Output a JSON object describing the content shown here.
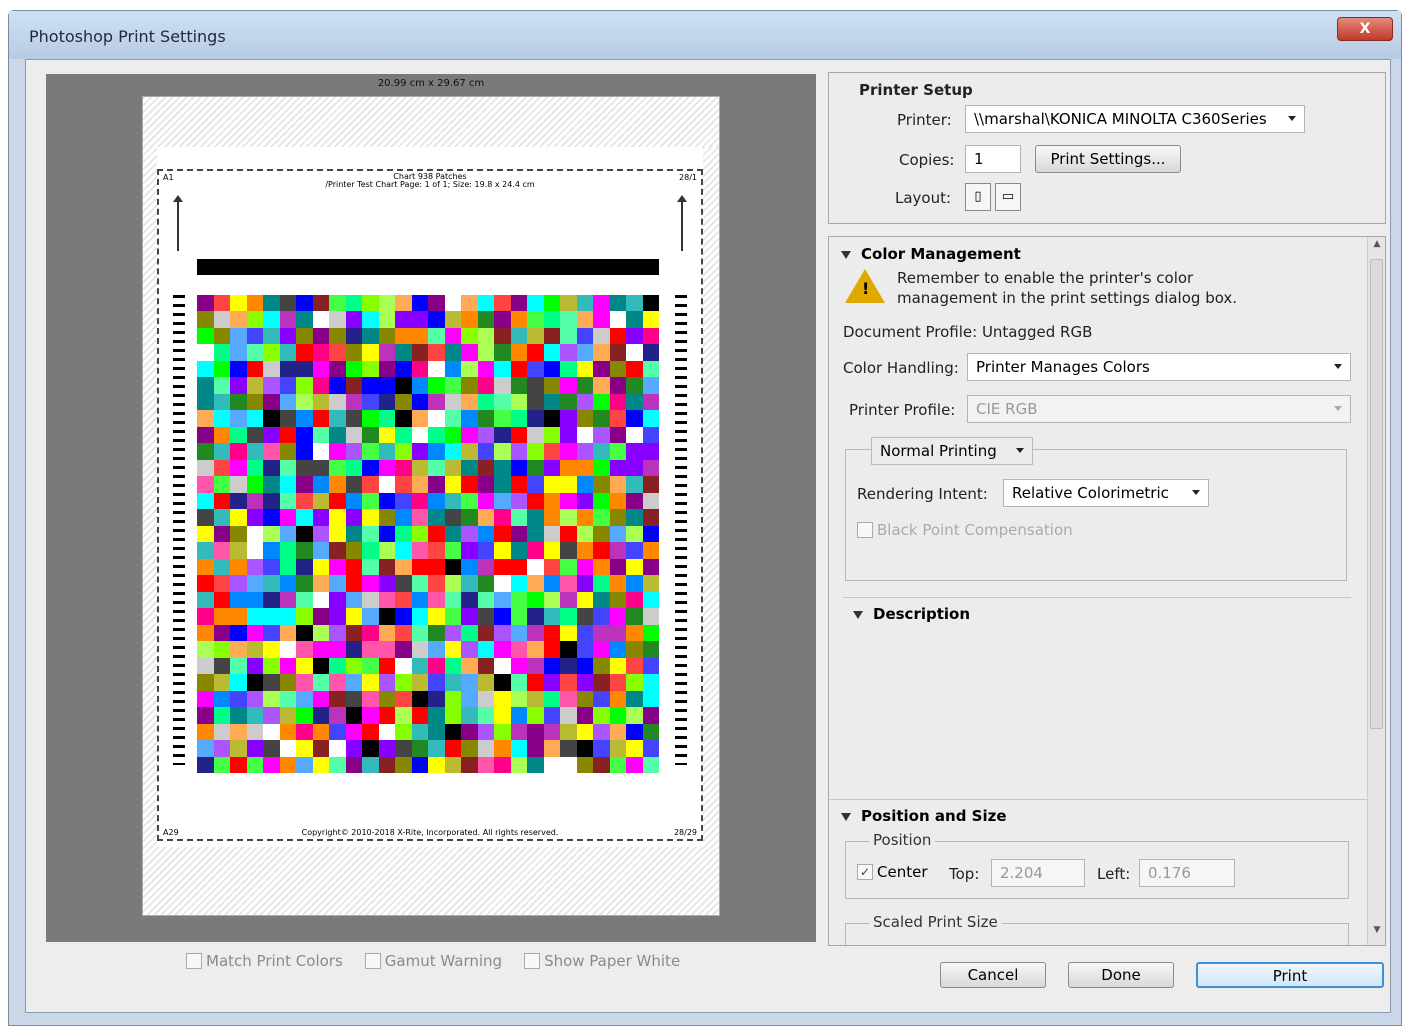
{
  "window": {
    "title": "Photoshop Print Settings",
    "close_label": "X"
  },
  "preview": {
    "page_size": "20.99 cm x 29.67 cm",
    "corner_tl": "A1",
    "corner_tr": "28/1",
    "corner_bl": "A29",
    "corner_br": "28/29",
    "chart_title": "Chart 938 Patches",
    "chart_subtitle": "/Printer Test Chart Page: 1 of 1; Size: 19.8 x 24.4 cm",
    "copyright": "Copyright© 2010-2018 X-Rite, Incorporated. All rights reserved.",
    "patch_colors": [
      "#ff0000",
      "#00ff00",
      "#0000ff",
      "#ffff00",
      "#ff00ff",
      "#00ffff",
      "#000000",
      "#ffffff",
      "#ff8800",
      "#88ff00",
      "#0088ff",
      "#8800ff",
      "#ff0088",
      "#00ff88",
      "#888800",
      "#008888",
      "#880088",
      "#444444",
      "#cccccc",
      "#ff4444",
      "#44ff44",
      "#4444ff",
      "#ffaa55",
      "#55aaff",
      "#aa55ff",
      "#55ffaa",
      "#aaff55",
      "#ff55aa",
      "#222288",
      "#882222",
      "#228822",
      "#bbbb33",
      "#33bbbb",
      "#bb33bb"
    ]
  },
  "under_preview": {
    "match_print_colors": "Match Print Colors",
    "gamut_warning": "Gamut Warning",
    "show_paper_white": "Show Paper White"
  },
  "printer_setup": {
    "heading": "Printer Setup",
    "printer_label": "Printer:",
    "printer_value": "\\\\marshal\\KONICA MINOLTA C360Series",
    "copies_label": "Copies:",
    "copies_value": "1",
    "print_settings_button": "Print Settings...",
    "layout_label": "Layout:",
    "layout_portrait": "▯",
    "layout_landscape": "▭"
  },
  "color_management": {
    "heading": "Color Management",
    "warning_line1": "Remember to enable the printer's color",
    "warning_line2": "management in the print settings dialog box.",
    "document_profile": "Document Profile: Untagged RGB",
    "color_handling_label": "Color Handling:",
    "color_handling_value": "Printer Manages Colors",
    "printer_profile_label": "Printer Profile:",
    "printer_profile_value": "CIE RGB",
    "printing_mode": "Normal Printing",
    "rendering_intent_label": "Rendering Intent:",
    "rendering_intent_value": "Relative Colorimetric",
    "black_point_label": "Black Point Compensation"
  },
  "description": {
    "heading": "Description"
  },
  "position_size": {
    "heading": "Position and Size",
    "position_label": "Position",
    "center_label": "Center",
    "top_label": "Top:",
    "top_value": "2.204",
    "left_label": "Left:",
    "left_value": "0.176",
    "scaled_label": "Scaled Print Size"
  },
  "buttons": {
    "cancel": "Cancel",
    "done": "Done",
    "print": "Print"
  }
}
